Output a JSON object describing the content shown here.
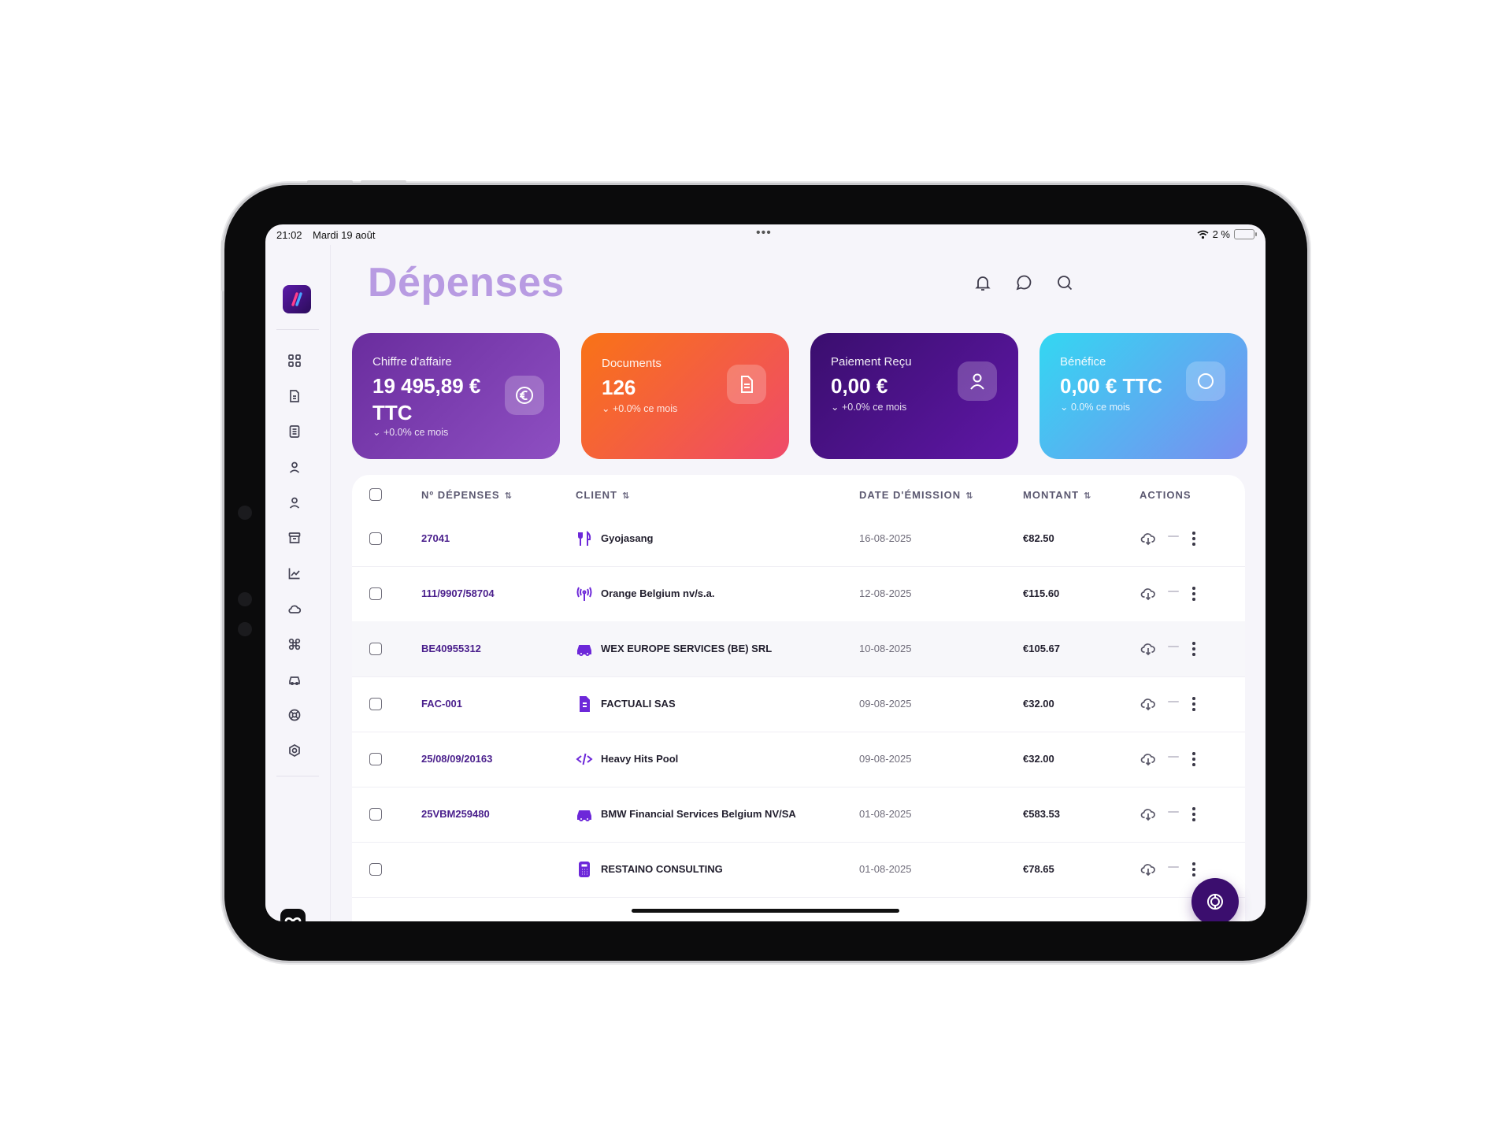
{
  "status_bar": {
    "time": "21:02",
    "date": "Mardi 19 août",
    "battery": "2 %"
  },
  "page": {
    "title": "Dépenses"
  },
  "header_icons": [
    "bell-icon",
    "chat-icon",
    "search-icon"
  ],
  "sidebar": {
    "items": [
      "dashboard-icon",
      "document-icon",
      "list-document-icon",
      "user-icon",
      "user-alt-icon",
      "archive-icon",
      "chart-icon",
      "cloud-icon",
      "command-icon",
      "car-icon",
      "support-icon",
      "settings-icon"
    ]
  },
  "cards": [
    {
      "label": "Chiffre d'affaire",
      "value_line1": "19 495,89 €",
      "value_line2": "TTC",
      "trend": "+0.0% ce mois",
      "icon": "euro-icon",
      "colors": [
        "#6a2d9e",
        "#8e4fc2"
      ]
    },
    {
      "label": "Documents",
      "value_line1": "126",
      "value_line2": "",
      "trend": "+0.0% ce mois",
      "icon": "document-icon",
      "colors": [
        "#f97316",
        "#ef4a6a"
      ]
    },
    {
      "label": "Paiement Reçu",
      "value_line1": "0,00 €",
      "value_line2": "",
      "trend": "+0.0% ce mois",
      "icon": "user-icon",
      "colors": [
        "#3a0e6e",
        "#5f17a6"
      ]
    },
    {
      "label": "Bénéfice",
      "value_line1": "0,00 € TTC",
      "value_line2": "",
      "trend": "0.0% ce mois",
      "icon": "circle-icon",
      "colors": [
        "#33d7f2",
        "#7b8df0"
      ]
    }
  ],
  "table": {
    "headers": {
      "number": "Nº DÉPENSES",
      "client": "CLIENT",
      "date": "DATE D'ÉMISSION",
      "amount": "MONTANT",
      "actions": "ACTIONS"
    },
    "sort_glyph": "⇅",
    "rows": [
      {
        "number": "27041",
        "client": "Gyojasang",
        "client_icon": "utensils-icon",
        "date": "16-08-2025",
        "amount": "€82.50"
      },
      {
        "number": "111/9907/58704",
        "client": "Orange Belgium nv/s.a.",
        "client_icon": "antenna-icon",
        "date": "12-08-2025",
        "amount": "€115.60"
      },
      {
        "number": "BE40955312",
        "client": "WEX EUROPE SERVICES (BE) SRL",
        "client_icon": "car-icon",
        "date": "10-08-2025",
        "amount": "€105.67"
      },
      {
        "number": "FAC-001",
        "client": "FACTUALI SAS",
        "client_icon": "invoice-icon",
        "date": "09-08-2025",
        "amount": "€32.00"
      },
      {
        "number": "25/08/09/20163",
        "client": "Heavy Hits Pool",
        "client_icon": "code-icon",
        "date": "09-08-2025",
        "amount": "€32.00"
      },
      {
        "number": "25VBM259480",
        "client": "BMW Financial Services Belgium NV/SA",
        "client_icon": "car-icon",
        "date": "01-08-2025",
        "amount": "€583.53"
      },
      {
        "number": "",
        "client": "RESTAINO CONSULTING",
        "client_icon": "calculator-icon",
        "date": "01-08-2025",
        "amount": "€78.65"
      }
    ]
  }
}
